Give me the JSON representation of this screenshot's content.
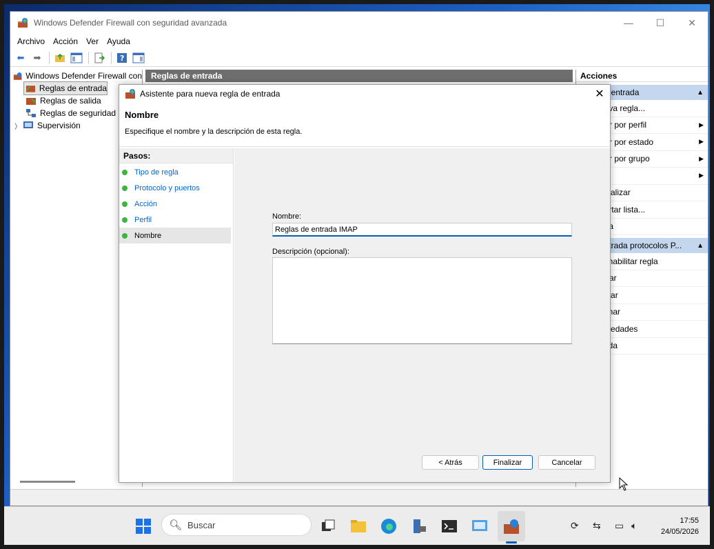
{
  "window": {
    "title": "Windows Defender Firewall con seguridad avanzada",
    "minimize": "—",
    "maximize": "☐",
    "close": "✕"
  },
  "menu": [
    "Archivo",
    "Acción",
    "Ver",
    "Ayuda"
  ],
  "tree": {
    "root": "Windows Defender Firewall con",
    "items": [
      "Reglas de entrada",
      "Reglas de salida",
      "Reglas de seguridad",
      "Supervisión"
    ]
  },
  "center": {
    "header": "Reglas de entrada"
  },
  "actions": {
    "header": "Acciones",
    "section1": "de entrada",
    "items1": [
      {
        "label": "ueva regla...",
        "arrow": ""
      },
      {
        "label": "trar por perfil",
        "arrow": "▶"
      },
      {
        "label": "trar por estado",
        "arrow": "▶"
      },
      {
        "label": "trar por grupo",
        "arrow": "▶"
      },
      {
        "label": "r",
        "arrow": "▶"
      },
      {
        "label": "ctualizar",
        "arrow": ""
      },
      {
        "label": "portar lista...",
        "arrow": ""
      },
      {
        "label": "uda",
        "arrow": ""
      }
    ],
    "section2": "entrada protocolos P...",
    "items2": [
      "eshabilitar regla",
      "ortar",
      "opiar",
      "minar",
      "opiedades",
      "yuda"
    ],
    "collapse": "▲"
  },
  "dialog": {
    "title": "Asistente para nueva regla de entrada",
    "close": "✕",
    "heading": "Nombre",
    "subtitle": "Especifique el nombre y la descripción de esta regla.",
    "steps_title": "Pasos:",
    "steps": [
      "Tipo de regla",
      "Protocolo y puertos",
      "Acción",
      "Perfil",
      "Nombre"
    ],
    "name_label": "Nombre:",
    "name_value": "Reglas de entrada IMAP",
    "desc_label": "Descripción (opcional):",
    "desc_value": "",
    "back_button": "< Atrás",
    "finish_button": "Finalizar",
    "cancel_button": "Cancelar"
  },
  "taskbar": {
    "search_placeholder": "Buscar",
    "time": "17:55",
    "date": "24/05/2026"
  }
}
